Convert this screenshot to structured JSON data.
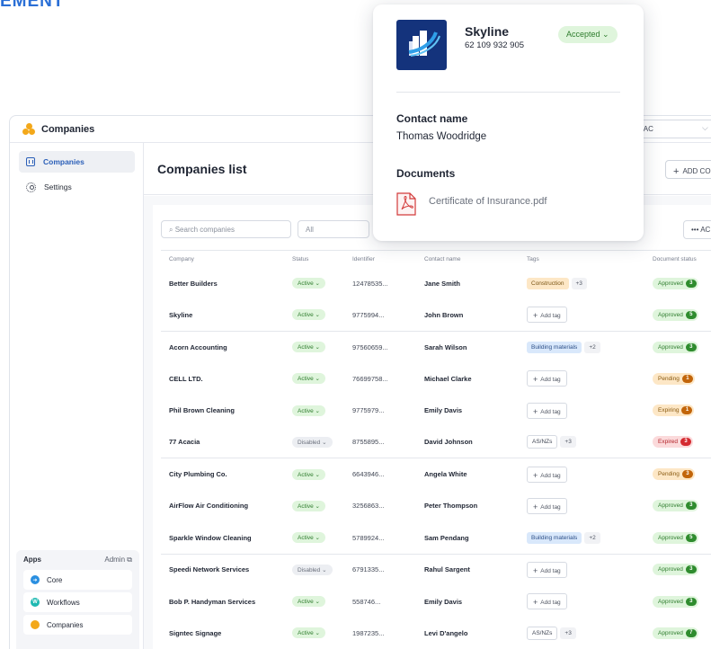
{
  "brand_fragment": "EMENT",
  "app": {
    "title": "Companies",
    "org_select": "PAC"
  },
  "sidebar": {
    "items": [
      {
        "label": "Companies",
        "icon": "building-icon",
        "active": true
      },
      {
        "label": "Settings",
        "icon": "gear-icon",
        "active": false
      }
    ],
    "apps": {
      "heading": "Apps",
      "admin_label": "Admin",
      "list": [
        {
          "label": "Core",
          "color": "#2a8fe0"
        },
        {
          "label": "Workflows",
          "color": "#1fb9b2"
        },
        {
          "label": "Companies",
          "color": "#f3a81a"
        }
      ]
    }
  },
  "main": {
    "title": "Companies list",
    "add_button": "ADD CO",
    "search_placeholder": "Search companies",
    "filter_value": "All",
    "more_button": "AC"
  },
  "table": {
    "headers": [
      "Company",
      "Status",
      "Identifier",
      "Contact name",
      "Tags",
      "Document status"
    ],
    "rows": [
      {
        "company": "Better Builders",
        "status": "Active",
        "identifier": "12478535...",
        "contact": "Jane Smith",
        "tags": [
          {
            "text": "Construction",
            "style": "orange"
          }
        ],
        "more": "+3",
        "doc": {
          "label": "Approved",
          "count": "3",
          "kind": "approved"
        }
      },
      {
        "company": "Skyline",
        "status": "Active",
        "identifier": "9775994...",
        "contact": "John Brown",
        "tags": [],
        "add_tag": "Add tag",
        "doc": {
          "label": "Approved",
          "count": "5",
          "kind": "approved"
        }
      },
      {
        "company": "Acorn Accounting",
        "status": "Active",
        "identifier": "97560659...",
        "contact": "Sarah Wilson",
        "tags": [
          {
            "text": "Building materials",
            "style": "blue"
          }
        ],
        "more": "+2",
        "doc": {
          "label": "Approved",
          "count": "3",
          "kind": "approved"
        }
      },
      {
        "company": "CELL LTD.",
        "status": "Active",
        "identifier": "76699758...",
        "contact": "Michael Clarke",
        "tags": [],
        "add_tag": "Add tag",
        "doc": {
          "label": "Pending",
          "count": "1",
          "kind": "pending"
        }
      },
      {
        "company": "Phil Brown Cleaning",
        "status": "Active",
        "identifier": "9775979...",
        "contact": "Emily Davis",
        "tags": [],
        "add_tag": "Add tag",
        "doc": {
          "label": "Expiring",
          "count": "1",
          "kind": "expiring"
        }
      },
      {
        "company": "77 Acacia",
        "status": "Disabled",
        "identifier": "8755895...",
        "contact": "David Johnson",
        "tags": [
          {
            "text": "AS/NZs",
            "style": "plain"
          }
        ],
        "more": "+3",
        "doc": {
          "label": "Expired",
          "count": "3",
          "kind": "expired"
        }
      },
      {
        "company": "City Plumbing Co.",
        "status": "Active",
        "identifier": "6643946...",
        "contact": "Angela White",
        "tags": [],
        "add_tag": "Add tag",
        "doc": {
          "label": "Pending",
          "count": "3",
          "kind": "pending"
        }
      },
      {
        "company": "AirFlow Air Conditioning",
        "status": "Active",
        "identifier": "3256863...",
        "contact": "Peter Thompson",
        "tags": [],
        "add_tag": "Add tag",
        "doc": {
          "label": "Approved",
          "count": "3",
          "kind": "approved"
        }
      },
      {
        "company": "Sparkle Window Cleaning",
        "status": "Active",
        "identifier": "5789924...",
        "contact": "Sam Pendang",
        "tags": [
          {
            "text": "Building materials",
            "style": "blue"
          }
        ],
        "more": "+2",
        "doc": {
          "label": "Approved",
          "count": "5",
          "kind": "approved"
        }
      },
      {
        "company": "Speedi Network Services",
        "status": "Disabled",
        "identifier": "6791335...",
        "contact": "Rahul Sargent",
        "tags": [],
        "add_tag": "Add tag",
        "doc": {
          "label": "Approved",
          "count": "3",
          "kind": "approved"
        }
      },
      {
        "company": "Bob P. Handyman Services",
        "status": "Active",
        "identifier": "558746...",
        "contact": "Emily Davis",
        "tags": [],
        "add_tag": "Add tag",
        "doc": {
          "label": "Approved",
          "count": "3",
          "kind": "approved"
        }
      },
      {
        "company": "Signtec Signage",
        "status": "Active",
        "identifier": "1987235...",
        "contact": "Levi D'angelo",
        "tags": [
          {
            "text": "AS/NZs",
            "style": "plain"
          }
        ],
        "more": "+3",
        "doc": {
          "label": "Approved",
          "count": "7",
          "kind": "approved"
        }
      }
    ]
  },
  "popover": {
    "company": "Skyline",
    "identifier": "62 109 932 905",
    "status": "Accepted",
    "contact_heading": "Contact name",
    "contact_name": "Thomas Woodridge",
    "documents_heading": "Documents",
    "document_file": "Certificate of Insurance.pdf"
  },
  "colors": {
    "accent": "#2b5fb8",
    "active_green": "#2f7d2e",
    "pending_orange": "#c2650a",
    "expired_red": "#d42a30",
    "logo_navy": "#14337c"
  }
}
